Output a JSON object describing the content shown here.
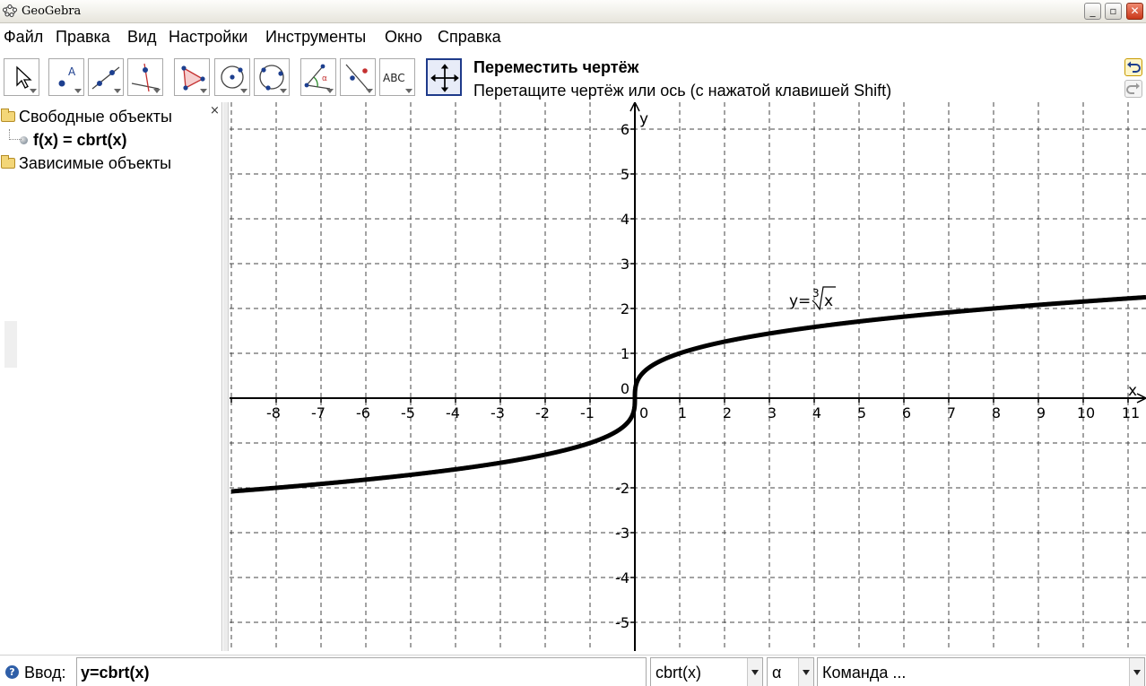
{
  "window": {
    "title": "GeoGebra",
    "buttons": [
      "_",
      "▫",
      "✕"
    ]
  },
  "menu": [
    "Файл",
    "Правка",
    "Вид",
    "Настройки",
    "Инструменты",
    "Окно",
    "Справка"
  ],
  "toolbar": {
    "tools": [
      "move-tool",
      "point-tool",
      "line-tool",
      "perpendicular-tool",
      "polygon-tool",
      "circle-tool",
      "conic-tool",
      "angle-tool",
      "reflect-tool",
      "text-tool",
      "move-view-tool"
    ],
    "text_tool_label": "ABC",
    "active_tool_name": "Переместить чертёж",
    "active_tool_help": "Перетащите чертёж или ось (с нажатой клавишей Shift)"
  },
  "algebra": {
    "close": "×",
    "free_objects": "Свободные объекты",
    "object": "f(x) = cbrt(x)",
    "dependent_objects": "Зависимые объекты"
  },
  "graphics": {
    "x_axis_label": "x",
    "y_axis_label": "y",
    "x_ticks": [
      "-8",
      "-7",
      "-6",
      "-5",
      "-4",
      "-3",
      "-2",
      "-1",
      "0",
      "1",
      "2",
      "3",
      "4",
      "5",
      "6",
      "7",
      "8",
      "9",
      "10",
      "11"
    ],
    "y_ticks": [
      "6",
      "5",
      "4",
      "3",
      "2",
      "1",
      "0",
      "-2",
      "-3",
      "-4",
      "-5"
    ],
    "curve_label": {
      "prefix": "y=",
      "index": "3",
      "radicand": "x"
    },
    "curve": {
      "function": "cbrt(x)",
      "x_range": [
        -9,
        11.4
      ],
      "y_range": [
        -5.6,
        6.6
      ],
      "grid": true,
      "color": "#000000"
    }
  },
  "input_bar": {
    "help": "?",
    "label": "Ввод:",
    "value": "y=cbrt(x)",
    "function_combo": "cbrt(x)",
    "symbol_combo": "α",
    "command_combo": "Команда ..."
  }
}
